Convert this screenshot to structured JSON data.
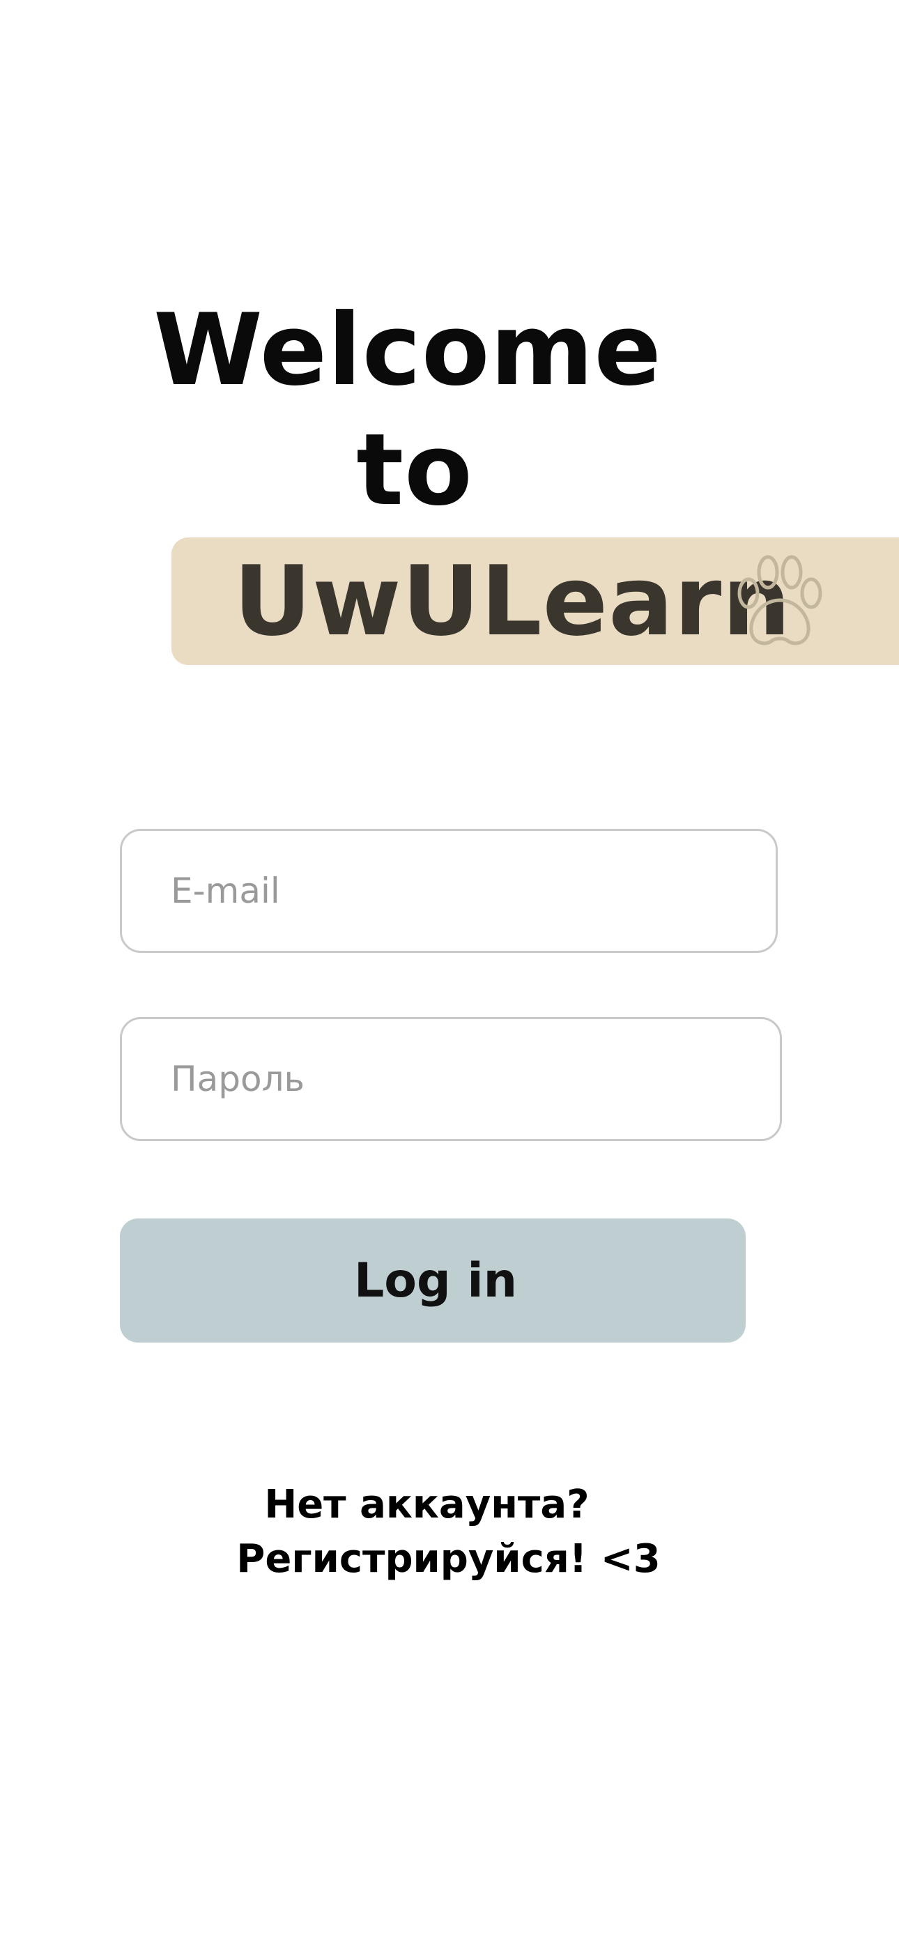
{
  "header": {
    "welcome_line1": "Welcome",
    "welcome_line2": "to",
    "brand_name": "UwULearn",
    "brand_icon": "paw-icon"
  },
  "form": {
    "email_placeholder": "E-mail",
    "password_placeholder": "Пароль",
    "login_label": "Log in"
  },
  "signup": {
    "line1": "Нет аккаунта?",
    "line2": "Регистрируйся! <3"
  },
  "colors": {
    "brand_band": "#e9dcc2",
    "brand_text": "#3a362d",
    "login_button": "#bfced1",
    "field_border": "#c9c9c9",
    "placeholder": "#9a9a9a"
  }
}
